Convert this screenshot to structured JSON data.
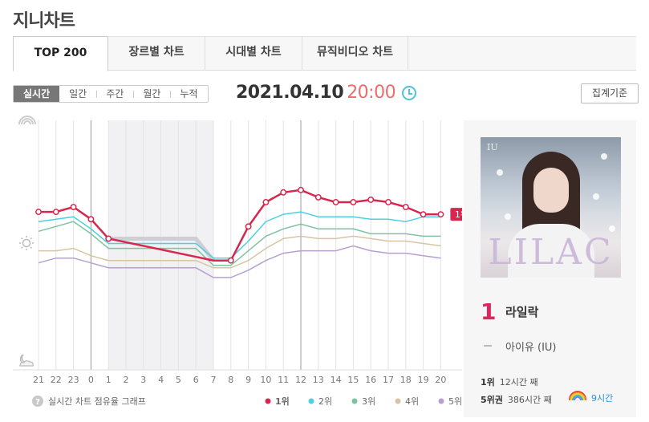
{
  "app": {
    "title": "지니차트"
  },
  "tabs": [
    {
      "label": "TOP 200",
      "active": true
    },
    {
      "label": "장르별 차트",
      "active": false
    },
    {
      "label": "시대별 차트",
      "active": false
    },
    {
      "label": "뮤직비디오 차트",
      "active": false
    }
  ],
  "periods": [
    {
      "label": "실시간",
      "active": true
    },
    {
      "label": "일간",
      "active": false
    },
    {
      "label": "주간",
      "active": false
    },
    {
      "label": "월간",
      "active": false
    },
    {
      "label": "누적",
      "active": false
    }
  ],
  "date": {
    "day": "2021.04.10",
    "time": "20:00"
  },
  "basis_button": "집계기준",
  "chart_data": {
    "type": "line",
    "title": "",
    "xlabel": "",
    "ylabel": "",
    "categories": [
      "21",
      "22",
      "23",
      "0",
      "1",
      "2",
      "3",
      "4",
      "5",
      "6",
      "7",
      "8",
      "9",
      "10",
      "11",
      "12",
      "13",
      "14",
      "15",
      "16",
      "17",
      "18",
      "19",
      "20"
    ],
    "note": "실시간 차트 점유율 그래프",
    "legend_position": "bottom-right",
    "ylim": [
      0,
      100
    ],
    "series": [
      {
        "name": "1위",
        "color": "#d8274f",
        "values": [
          63,
          63,
          65,
          60,
          52,
          null,
          null,
          null,
          null,
          null,
          null,
          43,
          57,
          67,
          71,
          72,
          69,
          67,
          67,
          68,
          67,
          65,
          62,
          62
        ]
      },
      {
        "name": "2위",
        "color": "#4fcfe2",
        "values": [
          59,
          60,
          61,
          56,
          50,
          50,
          50,
          50,
          50,
          50,
          null,
          44,
          51,
          59,
          62,
          63,
          61,
          61,
          61,
          60,
          60,
          59,
          61,
          61
        ]
      },
      {
        "name": "3위",
        "color": "#7fc2a2",
        "values": [
          55,
          57,
          59,
          54,
          48,
          48,
          48,
          48,
          48,
          48,
          null,
          41,
          47,
          53,
          56,
          58,
          56,
          56,
          56,
          54,
          54,
          54,
          53,
          53
        ]
      },
      {
        "name": "4위",
        "color": "#d8c4a2",
        "values": [
          47,
          47,
          48,
          45,
          43,
          43,
          43,
          43,
          43,
          43,
          null,
          40,
          43,
          48,
          52,
          53,
          52,
          52,
          53,
          52,
          51,
          51,
          50,
          49
        ]
      },
      {
        "name": "5위",
        "color": "#b7a0d0",
        "values": [
          42,
          44,
          44,
          42,
          40,
          40,
          40,
          40,
          40,
          40,
          null,
          36,
          39,
          43,
          46,
          47,
          47,
          47,
          49,
          47,
          46,
          46,
          45,
          44
        ]
      }
    ],
    "current_label": "1위"
  },
  "song": {
    "rank": "1",
    "title": "라일락",
    "artist": "아이유 (IU)",
    "album_text": "LILAC",
    "album_small_text": "IU"
  },
  "stats": [
    {
      "label": "1위",
      "value": "12시간 째"
    },
    {
      "label": "5위권",
      "value": "386시간 째"
    }
  ],
  "rainbow_hours": "9시간",
  "icons": {
    "rainbow": "rainbow-icon",
    "sun": "sun-icon",
    "night": "night-icon",
    "clock": "clock-icon",
    "help": "help-icon"
  }
}
